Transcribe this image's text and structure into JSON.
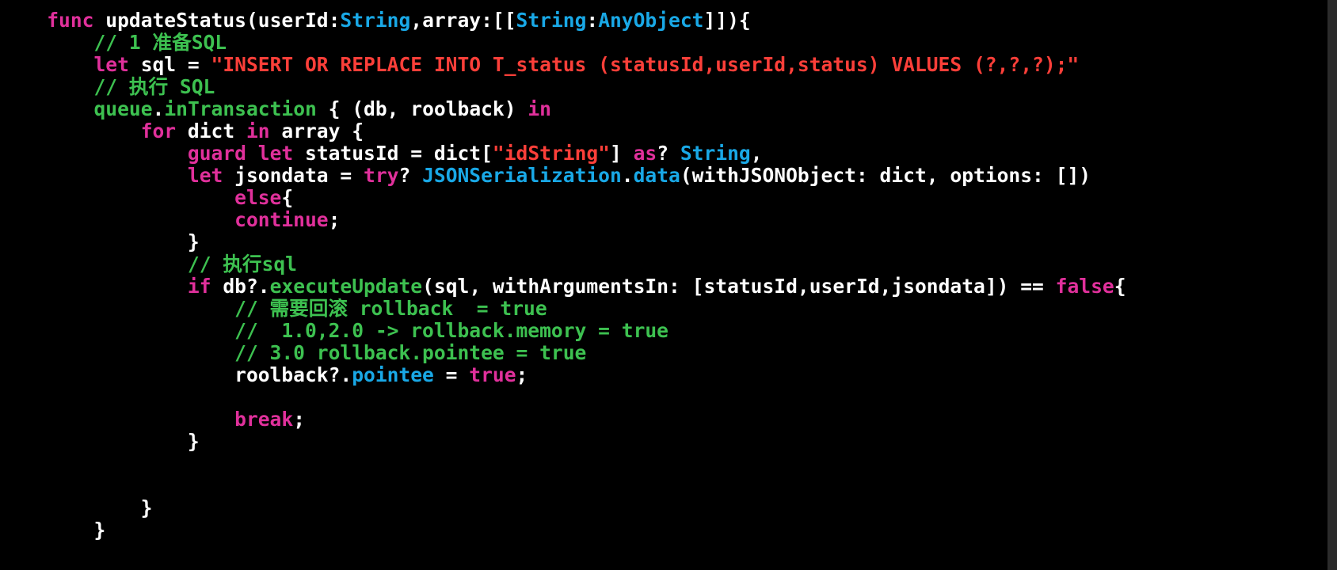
{
  "colors": {
    "background": "#000000",
    "plain": "#ffffff",
    "keyword": "#e0309b",
    "type": "#19a8e6",
    "string": "#fc3f39",
    "comment": "#3dc150",
    "func": "#3dc150"
  },
  "code": {
    "lines": [
      [
        [
          "plain",
          "    "
        ],
        [
          "keyword",
          "func"
        ],
        [
          "plain",
          " updateStatus(userId:"
        ],
        [
          "type",
          "String"
        ],
        [
          "plain",
          ",array:[["
        ],
        [
          "type",
          "String"
        ],
        [
          "plain",
          ":"
        ],
        [
          "type",
          "AnyObject"
        ],
        [
          "plain",
          "]]){"
        ]
      ],
      [
        [
          "plain",
          "        "
        ],
        [
          "comment",
          "// 1 准备SQL"
        ]
      ],
      [
        [
          "plain",
          "        "
        ],
        [
          "keyword",
          "let"
        ],
        [
          "plain",
          " sql = "
        ],
        [
          "string",
          "\"INSERT OR REPLACE INTO T_status (statusId,userId,status) VALUES (?,?,?);\""
        ]
      ],
      [
        [
          "plain",
          "        "
        ],
        [
          "comment",
          "// 执行 SQL"
        ]
      ],
      [
        [
          "plain",
          "        "
        ],
        [
          "func",
          "queue"
        ],
        [
          "plain",
          "."
        ],
        [
          "func",
          "inTransaction"
        ],
        [
          "plain",
          " { (db, roolback) "
        ],
        [
          "keyword",
          "in"
        ]
      ],
      [
        [
          "plain",
          "            "
        ],
        [
          "keyword",
          "for"
        ],
        [
          "plain",
          " dict "
        ],
        [
          "keyword",
          "in"
        ],
        [
          "plain",
          " array {"
        ]
      ],
      [
        [
          "plain",
          "                "
        ],
        [
          "keyword",
          "guard"
        ],
        [
          "plain",
          " "
        ],
        [
          "keyword",
          "let"
        ],
        [
          "plain",
          " statusId = dict["
        ],
        [
          "string",
          "\"idString\""
        ],
        [
          "plain",
          "] "
        ],
        [
          "keyword",
          "as"
        ],
        [
          "plain",
          "? "
        ],
        [
          "type",
          "String"
        ],
        [
          "plain",
          ","
        ]
      ],
      [
        [
          "plain",
          "                "
        ],
        [
          "keyword",
          "let"
        ],
        [
          "plain",
          " jsondata = "
        ],
        [
          "keyword",
          "try"
        ],
        [
          "plain",
          "? "
        ],
        [
          "type",
          "JSONSerialization"
        ],
        [
          "plain",
          "."
        ],
        [
          "type",
          "data"
        ],
        [
          "plain",
          "(withJSONObject: dict, options: [])"
        ]
      ],
      [
        [
          "plain",
          "                    "
        ],
        [
          "keyword",
          "else"
        ],
        [
          "plain",
          "{"
        ]
      ],
      [
        [
          "plain",
          "                    "
        ],
        [
          "keyword",
          "continue"
        ],
        [
          "plain",
          ";"
        ]
      ],
      [
        [
          "plain",
          "                }"
        ]
      ],
      [
        [
          "plain",
          "                "
        ],
        [
          "comment",
          "// 执行sql"
        ]
      ],
      [
        [
          "plain",
          "                "
        ],
        [
          "keyword",
          "if"
        ],
        [
          "plain",
          " db?."
        ],
        [
          "func",
          "executeUpdate"
        ],
        [
          "plain",
          "(sql, withArgumentsIn: [statusId,userId,jsondata]) == "
        ],
        [
          "keyword",
          "false"
        ],
        [
          "plain",
          "{"
        ]
      ],
      [
        [
          "plain",
          "                    "
        ],
        [
          "comment",
          "// 需要回滚 rollback  = true"
        ]
      ],
      [
        [
          "plain",
          "                    "
        ],
        [
          "comment",
          "//  1.0,2.0 -> rollback.memory = true"
        ]
      ],
      [
        [
          "plain",
          "                    "
        ],
        [
          "comment",
          "// 3.0 rollback.pointee = true"
        ]
      ],
      [
        [
          "plain",
          "                    roolback?."
        ],
        [
          "type",
          "pointee"
        ],
        [
          "plain",
          " = "
        ],
        [
          "keyword",
          "true"
        ],
        [
          "plain",
          ";"
        ]
      ],
      [],
      [
        [
          "plain",
          "                    "
        ],
        [
          "keyword",
          "break"
        ],
        [
          "plain",
          ";"
        ]
      ],
      [
        [
          "plain",
          "                }"
        ]
      ],
      [],
      [],
      [
        [
          "plain",
          "            }"
        ]
      ],
      [
        [
          "plain",
          "        }"
        ]
      ]
    ]
  }
}
